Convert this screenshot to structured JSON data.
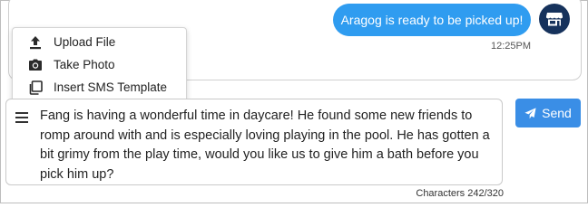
{
  "thread": {
    "message": "Aragog is ready to be picked up!",
    "timestamp": "12:25PM",
    "avatar_icon": "store-icon"
  },
  "attach_menu": {
    "items": [
      {
        "label": "Upload File",
        "icon": "upload-icon"
      },
      {
        "label": "Take Photo",
        "icon": "camera-icon"
      },
      {
        "label": "Insert SMS Template",
        "icon": "copy-template-icon"
      }
    ]
  },
  "composer": {
    "text": "Fang is having a wonderful time in daycare! He found some new friends to romp around with and is especially loving playing in the pool. He has gotten a bit grimy from the play time, would you like us to give him a bath before you pick him up?",
    "menu_icon": "hamburger-menu-icon"
  },
  "send": {
    "label": "Send",
    "icon": "paper-plane-icon"
  },
  "char_count": "Characters 242/320",
  "colors": {
    "bubble": "#2f9cf0",
    "avatar": "#16325c",
    "send_button": "#3a8ee6"
  }
}
